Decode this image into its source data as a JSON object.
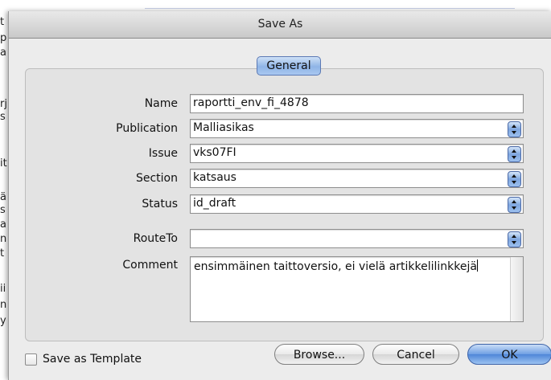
{
  "background": {
    "left_edge_chars": [
      "t",
      "p",
      "a",
      "rj",
      "s",
      "it",
      "ä",
      "s",
      "a",
      "n",
      "t",
      "ii",
      "n",
      "y"
    ]
  },
  "dialog": {
    "title": "Save As",
    "tab_label": "General",
    "fields": {
      "name": {
        "label": "Name",
        "value": "raportti_env_fi_4878"
      },
      "publication": {
        "label": "Publication",
        "value": "Malliasikas"
      },
      "issue": {
        "label": "Issue",
        "value": "vks07FI"
      },
      "section": {
        "label": "Section",
        "value": "katsaus"
      },
      "status": {
        "label": "Status",
        "value": "id_draft"
      },
      "route_to": {
        "label": "RouteTo",
        "value": ""
      },
      "comment": {
        "label": "Comment",
        "value": "ensimmäinen taittoversio, ei vielä artikkelilinkkejä"
      }
    },
    "save_as_template": {
      "label": "Save as Template",
      "checked": false
    },
    "buttons": {
      "browse": "Browse...",
      "cancel": "Cancel",
      "ok": "OK"
    },
    "colors": {
      "accent": "#6e9fe3",
      "window_bg": "#ececec"
    }
  }
}
